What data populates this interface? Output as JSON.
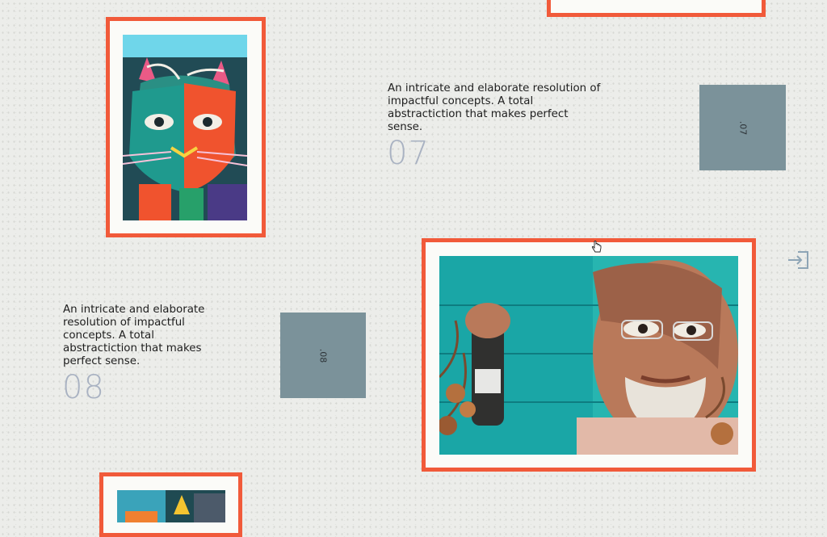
{
  "items": [
    {
      "caption": "An intricate and elaborate resolution of impactful concepts. A total abstractiction that makes perfect sense.",
      "number": "07",
      "tile_label": ".07"
    },
    {
      "caption": "An intricate and elaborate resolution of impactful concepts. A total abstractiction that makes perfect sense.",
      "number": "08",
      "tile_label": ".08"
    }
  ],
  "icons": {
    "exit": "exit-icon",
    "cursor": "hand-cursor-icon"
  },
  "colors": {
    "frame": "#f15a3a",
    "tile": "#7b929a",
    "number": "#a9b2c2",
    "background": "#ecedea"
  }
}
